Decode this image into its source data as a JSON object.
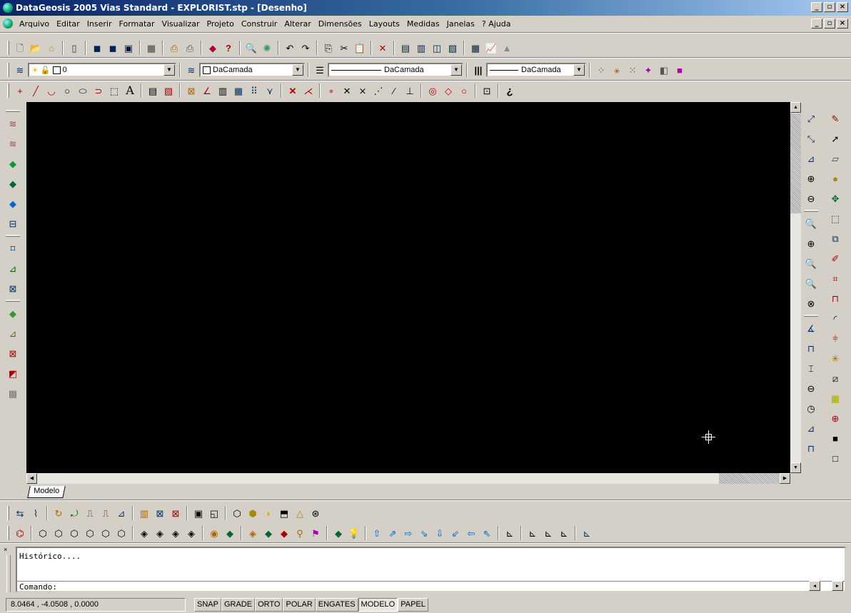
{
  "window": {
    "title": "DataGeosis 2005 Vias Standard - EXPLORIST.stp - [Desenho]",
    "min": "_",
    "max": "🗗",
    "close": "x"
  },
  "menu": [
    {
      "label": "Arquivo"
    },
    {
      "label": "Editar"
    },
    {
      "label": "Inserir"
    },
    {
      "label": "Formatar"
    },
    {
      "label": "Visualizar"
    },
    {
      "label": "Projeto"
    },
    {
      "label": "Construir"
    },
    {
      "label": "Alterar"
    },
    {
      "label": "Dimensões"
    },
    {
      "label": "Layouts"
    },
    {
      "label": "Medidas"
    },
    {
      "label": "Janelas"
    },
    {
      "label": "? Ajuda"
    }
  ],
  "properties": {
    "layer_value": "0",
    "color_value": "DaCamada",
    "linetype_value": "DaCamada",
    "lineweight_value": "DaCamada"
  },
  "tab": {
    "label": "Modelo"
  },
  "command": {
    "history": "Histórico....",
    "prompt": "Comando:"
  },
  "status": {
    "coords": "8.0464 , -4.0508 , 0.0000",
    "toggles": [
      "SNAP",
      "GRADE",
      "ORTO",
      "POLAR",
      "ENGATES",
      "MODELO",
      "PAPEL"
    ]
  },
  "colors": {
    "canvas": "#000000",
    "face": "#d4d0c8",
    "titlebar": "#0a246a"
  }
}
